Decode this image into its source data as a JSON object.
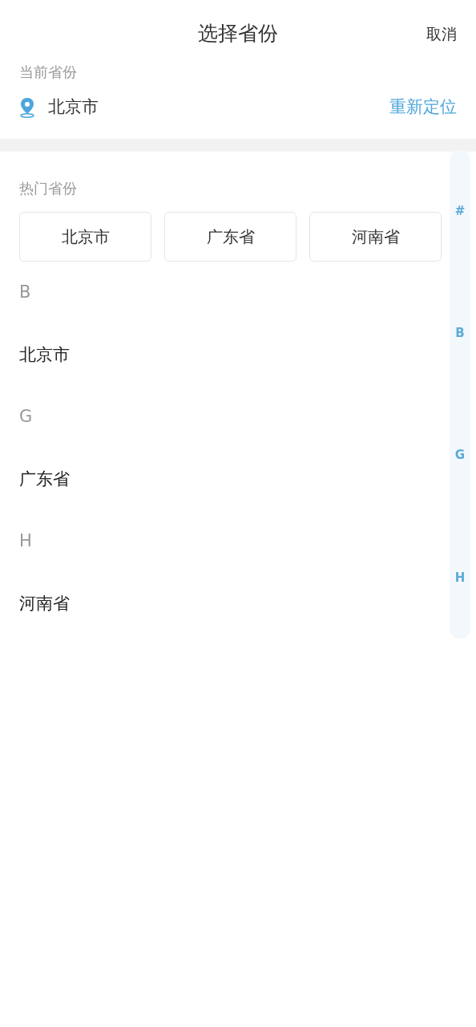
{
  "header": {
    "title": "选择省份",
    "cancel": "取消"
  },
  "current": {
    "label": "当前省份",
    "province": "北京市",
    "relocate": "重新定位"
  },
  "hot": {
    "label": "热门省份",
    "items": [
      "北京市",
      "广东省",
      "河南省"
    ]
  },
  "sections": [
    {
      "letter": "B",
      "items": [
        "北京市"
      ]
    },
    {
      "letter": "G",
      "items": [
        "广东省"
      ]
    },
    {
      "letter": "H",
      "items": [
        "河南省"
      ]
    }
  ],
  "index": [
    "#",
    "B",
    "G",
    "H"
  ]
}
